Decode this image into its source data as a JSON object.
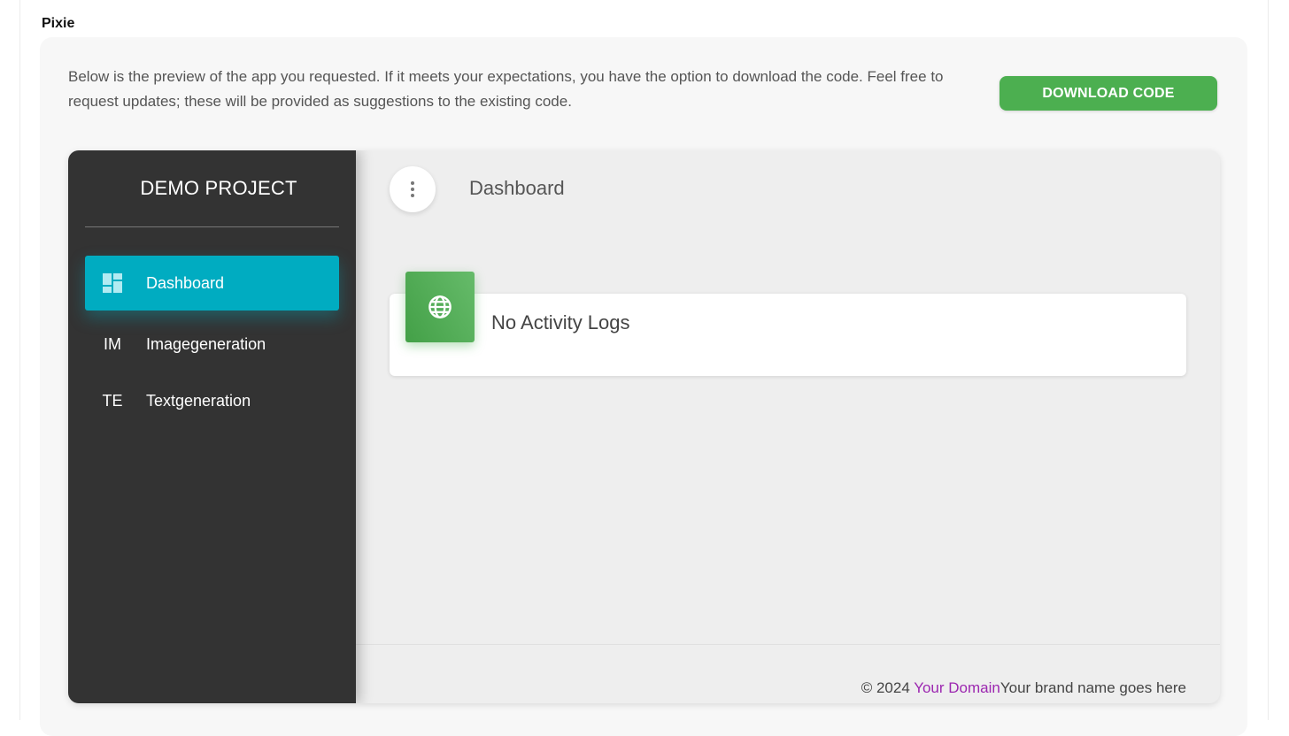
{
  "app": {
    "label": "Pixie"
  },
  "preview": {
    "intro": "Below is the preview of the app you requested. If it meets your expectations, you have the option to download the code. Feel free to request updates; these will be provided as suggestions to the existing code.",
    "download_label": "DOWNLOAD CODE",
    "download_color": "#4caf50"
  },
  "demo": {
    "brand": "DEMO PROJECT",
    "sidebar": {
      "bg_color": "#333333",
      "active_color": "#00acc1",
      "items": [
        {
          "icon": "dashboard-icon",
          "icon_text": "",
          "label": "Dashboard",
          "active": true
        },
        {
          "icon": "text-abbrev",
          "icon_text": "IM",
          "label": "Imagegeneration",
          "active": false
        },
        {
          "icon": "text-abbrev",
          "icon_text": "TE",
          "label": "Textgeneration",
          "active": false
        }
      ]
    },
    "header": {
      "title": "Dashboard"
    },
    "activity": {
      "title": "No Activity Logs",
      "icon": "globe-icon",
      "icon_color": "#4caf50"
    },
    "footer": {
      "copyright": "© 2024 ",
      "link_text": "Your Domain",
      "tagline": "Your brand name goes here",
      "link_color": "#9c27b0"
    }
  }
}
